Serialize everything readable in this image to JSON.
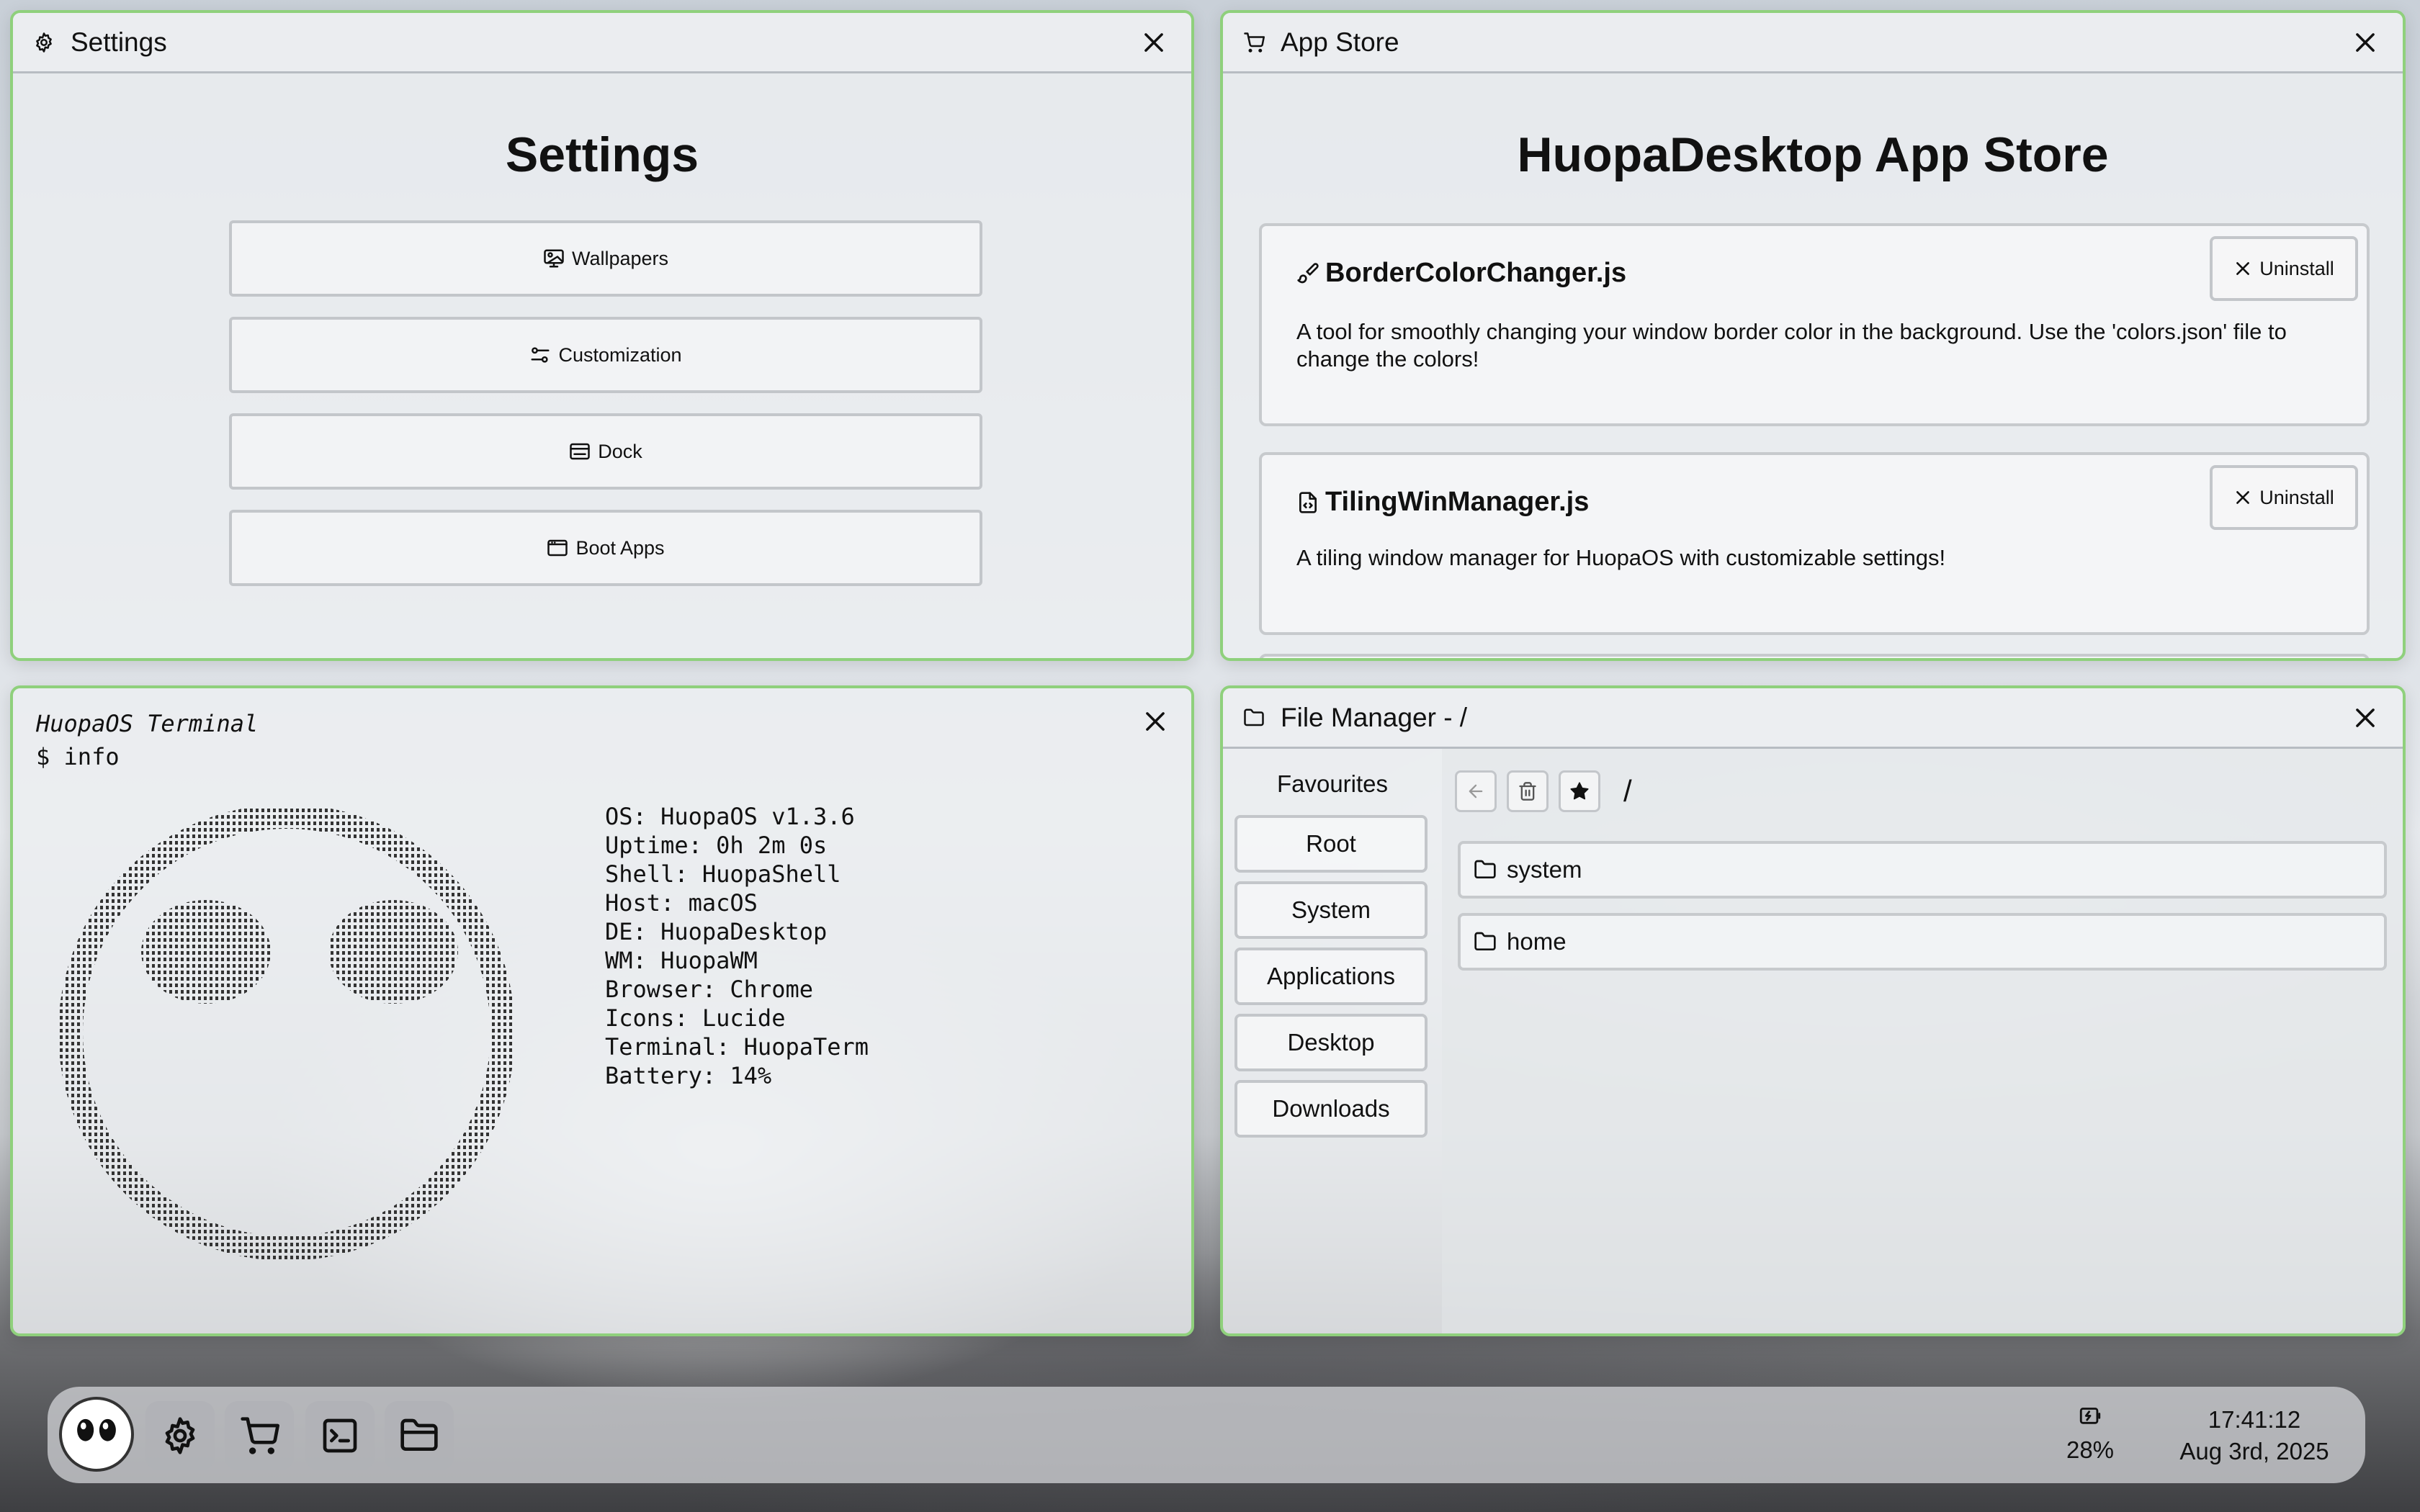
{
  "settings": {
    "title": "Settings",
    "heading": "Settings",
    "buttons": [
      {
        "label": "Wallpapers",
        "icon": "image-icon"
      },
      {
        "label": "Customization",
        "icon": "sliders-icon"
      },
      {
        "label": "Dock",
        "icon": "dock-icon"
      },
      {
        "label": "Boot Apps",
        "icon": "app-window-icon"
      }
    ]
  },
  "store": {
    "title": "App Store",
    "heading": "HuopaDesktop App Store",
    "apps": [
      {
        "name": "BorderColorChanger.js",
        "description": "A tool for smoothly changing your window border color in the background. Use the 'colors.json' file to change the colors!",
        "action": "Uninstall",
        "icon": "paintbrush-icon"
      },
      {
        "name": "TilingWinManager.js",
        "description": "A tiling window manager for HuopaOS with customizable settings!",
        "action": "Uninstall",
        "icon": "file-code-icon"
      }
    ]
  },
  "terminal": {
    "title": "HuopaOS Terminal",
    "command": "$ info",
    "info": [
      "OS: HuopaOS v1.3.6",
      "Uptime: 0h 2m 0s",
      "Shell: HuopaShell",
      "Host: macOS",
      "DE: HuopaDesktop",
      "WM: HuopaWM",
      "Browser: Chrome",
      "Icons: Lucide",
      "Terminal: HuopaTerm",
      "Battery: 14%"
    ]
  },
  "files": {
    "title": "File Manager - /",
    "favourites_label": "Favourites",
    "favourites": [
      "Root",
      "System",
      "Applications",
      "Desktop",
      "Downloads"
    ],
    "path": "/",
    "entries": [
      {
        "name": "system",
        "icon": "folder-icon"
      },
      {
        "name": "home",
        "icon": "folder-icon"
      }
    ]
  },
  "dock": {
    "apps": [
      "huopa-logo",
      "settings-icon",
      "shopping-cart-icon",
      "terminal-icon",
      "folder-icon"
    ],
    "battery": "28%",
    "time": "17:41:12",
    "date": "Aug 3rd, 2025"
  },
  "colors": {
    "window_border": "#8fd07c",
    "window_bg": "#eceef1"
  }
}
